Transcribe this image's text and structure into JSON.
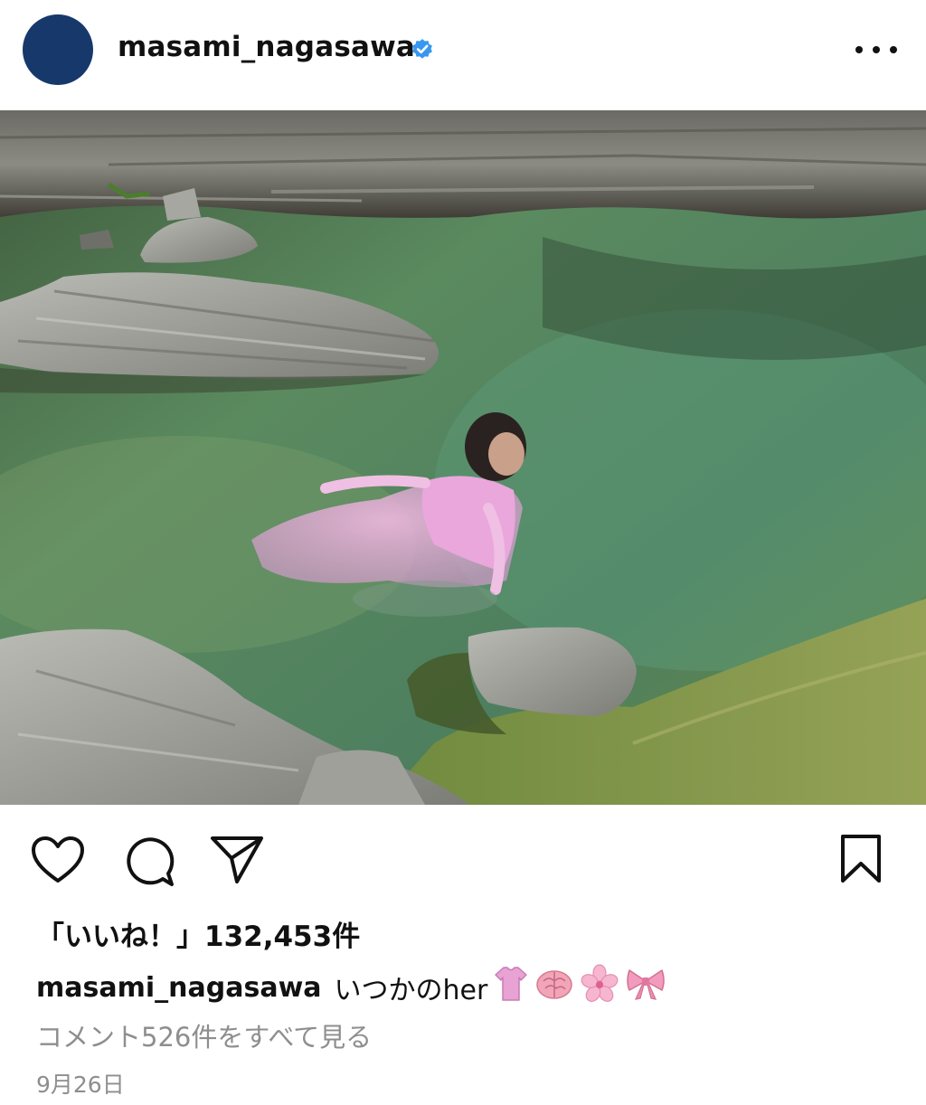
{
  "header": {
    "username": "masami_nagasawa",
    "avatar_color": "#17386b",
    "verified_color": "#3897f0",
    "avatar_icon": "avatar",
    "verified_icon": "verified-badge-icon",
    "more_icon": "more-options-icon"
  },
  "post": {
    "colors": {
      "water": "#4f7a55",
      "rock": "#9a9b96",
      "dress": "#e6a9d6"
    }
  },
  "actions": {
    "like_icon": "heart-icon",
    "comment_icon": "comment-icon",
    "share_icon": "send-icon",
    "save_icon": "bookmark-icon"
  },
  "likes": {
    "text": "「いいね！」132,453件"
  },
  "caption": {
    "username": "masami_nagasawa",
    "text": "いつかのher",
    "emojis": [
      "dress-emoji",
      "brain-emoji",
      "cherry-blossom-emoji",
      "ribbon-emoji"
    ]
  },
  "comments": {
    "link_text": "コメント526件をすべて見る"
  },
  "date": {
    "text": "9月26日"
  }
}
